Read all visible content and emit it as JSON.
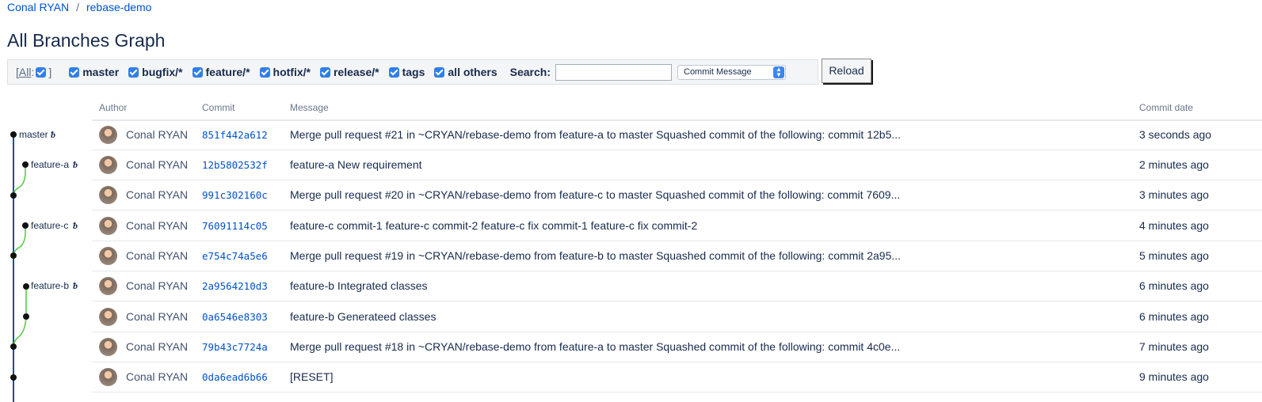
{
  "breadcrumb": {
    "project": "Conal RYAN",
    "separator": "/",
    "repo": "rebase-demo"
  },
  "page": {
    "title": "All Branches Graph"
  },
  "filters": {
    "all_open": "[",
    "all_label": "All",
    "all_colon": ":",
    "all_close": "]",
    "items": [
      {
        "label": "master",
        "checked": true
      },
      {
        "label": "bugfix/*",
        "checked": true
      },
      {
        "label": "feature/*",
        "checked": true
      },
      {
        "label": "hotfix/*",
        "checked": true
      },
      {
        "label": "release/*",
        "checked": true
      },
      {
        "label": "tags",
        "checked": true
      },
      {
        "label": "all others",
        "checked": true
      }
    ],
    "search_label": "Search:",
    "search_value": "",
    "search_type": "Commit Message",
    "reload_label": "Reload"
  },
  "table": {
    "headers": {
      "author": "Author",
      "commit": "Commit",
      "message": "Message",
      "date": "Commit date"
    },
    "rows": [
      {
        "author": "Conal RYAN",
        "commit": "851f442a612",
        "message": "Merge pull request #21 in ~CRYAN/rebase-demo from feature-a to master Squashed commit of the following: commit 12b5...",
        "date": "3 seconds ago"
      },
      {
        "author": "Conal RYAN",
        "commit": "12b5802532f",
        "message": "feature-a New requirement",
        "date": "2 minutes ago"
      },
      {
        "author": "Conal RYAN",
        "commit": "991c302160c",
        "message": "Merge pull request #20 in ~CRYAN/rebase-demo from feature-c to master Squashed commit of the following: commit 7609...",
        "date": "3 minutes ago"
      },
      {
        "author": "Conal RYAN",
        "commit": "76091114c05",
        "message": "feature-c commit-1 feature-c commit-2 feature-c fix commit-1 feature-c fix commit-2",
        "date": "4 minutes ago"
      },
      {
        "author": "Conal RYAN",
        "commit": "e754c74a5e6",
        "message": "Merge pull request #19 in ~CRYAN/rebase-demo from feature-b to master Squashed commit of the following: commit 2a95...",
        "date": "5 minutes ago"
      },
      {
        "author": "Conal RYAN",
        "commit": "2a9564210d3",
        "message": "feature-b Integrated classes",
        "date": "6 minutes ago"
      },
      {
        "author": "Conal RYAN",
        "commit": "0a6546e8303",
        "message": "feature-b Generateed classes",
        "date": "6 minutes ago"
      },
      {
        "author": "Conal RYAN",
        "commit": "79b43c7724a",
        "message": "Merge pull request #18 in ~CRYAN/rebase-demo from feature-a to master Squashed commit of the following: commit 4c0e...",
        "date": "7 minutes ago"
      },
      {
        "author": "Conal RYAN",
        "commit": "0da6ead6b66",
        "message": "[RESET]",
        "date": "9 minutes ago"
      }
    ]
  },
  "graph": {
    "labels": [
      "master",
      "feature-a",
      "feature-c",
      "feature-b"
    ],
    "tag_glyph": "ᵬ",
    "colors": {
      "master": "#1f4e9a",
      "branch": "#5cc94a",
      "node": "#111111"
    }
  }
}
